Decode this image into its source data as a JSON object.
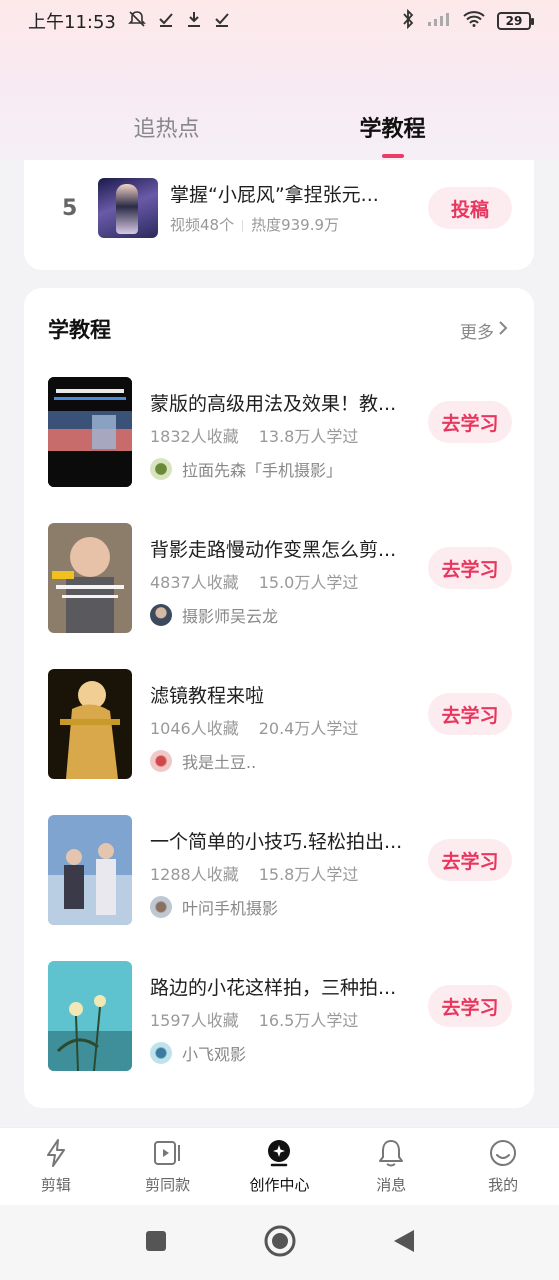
{
  "status_bar": {
    "time": "上午11:53",
    "battery": "29"
  },
  "top_tabs": [
    {
      "label": "追热点",
      "active": false
    },
    {
      "label": "学教程",
      "active": true
    }
  ],
  "hot_rank_item": {
    "rank": "5",
    "title": "掌握“小屁风”拿捏张元...",
    "video_count": "视频48个",
    "heat": "热度939.9万",
    "action_label": "投稿"
  },
  "tutorials_section": {
    "title": "学教程",
    "more_label": "更多",
    "action_label": "去学习",
    "items": [
      {
        "title": "蒙版的高级用法及效果！教...",
        "favorites": "1832人收藏",
        "learners": "13.8万人学过",
        "author": "拉面先森「手机摄影」"
      },
      {
        "title": "背影走路慢动作变黑怎么剪...",
        "favorites": "4837人收藏",
        "learners": "15.0万人学过",
        "author": "摄影师吴云龙"
      },
      {
        "title": "滤镜教程来啦",
        "favorites": "1046人收藏",
        "learners": "20.4万人学过",
        "author": "我是土豆.."
      },
      {
        "title": "一个简单的小技巧.轻松拍出...",
        "favorites": "1288人收藏",
        "learners": "15.8万人学过",
        "author": "叶问手机摄影"
      },
      {
        "title": "路边的小花这样拍，三种拍...",
        "favorites": "1597人收藏",
        "learners": "16.5万人学过",
        "author": "小飞观影"
      }
    ]
  },
  "bottom_nav": [
    {
      "label": "剪辑",
      "icon": "lightning-icon"
    },
    {
      "label": "剪同款",
      "icon": "video-template-icon"
    },
    {
      "label": "创作中心",
      "icon": "creator-center-icon",
      "active": true
    },
    {
      "label": "消息",
      "icon": "bell-icon"
    },
    {
      "label": "我的",
      "icon": "smile-icon"
    }
  ],
  "colors": {
    "accent": "#e9365e",
    "pill_bg": "#fdecef",
    "page_bg": "#f3f2f4"
  }
}
